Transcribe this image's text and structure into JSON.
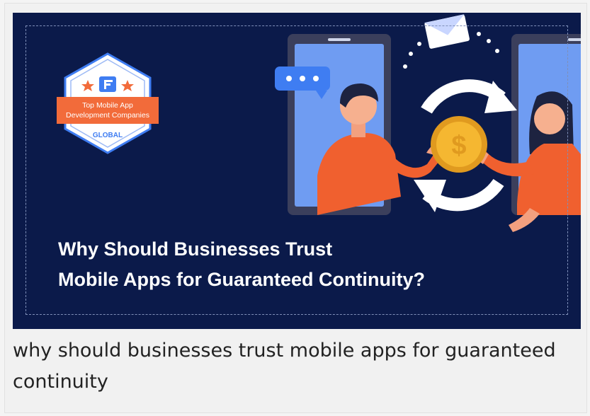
{
  "badge": {
    "line1": "Top Mobile App",
    "line2": "Development Companies",
    "region": "GLOBAL"
  },
  "banner": {
    "title_line1": "Why Should Businesses Trust",
    "title_line2": "Mobile Apps for Guaranteed Continuity?"
  },
  "caption": "why should businesses trust mobile apps for guaranteed continuity",
  "colors": {
    "banner_bg": "#0b1a4a",
    "accent_orange": "#f26b3a",
    "phone_frame": "#3b3f5c",
    "screen_blue": "#5b8ef0",
    "coin_gold": "#f5b731"
  },
  "icons": [
    "chat-bubble-icon",
    "envelope-icon",
    "dollar-coin-icon",
    "exchange-arrows-icon",
    "star-icon"
  ]
}
